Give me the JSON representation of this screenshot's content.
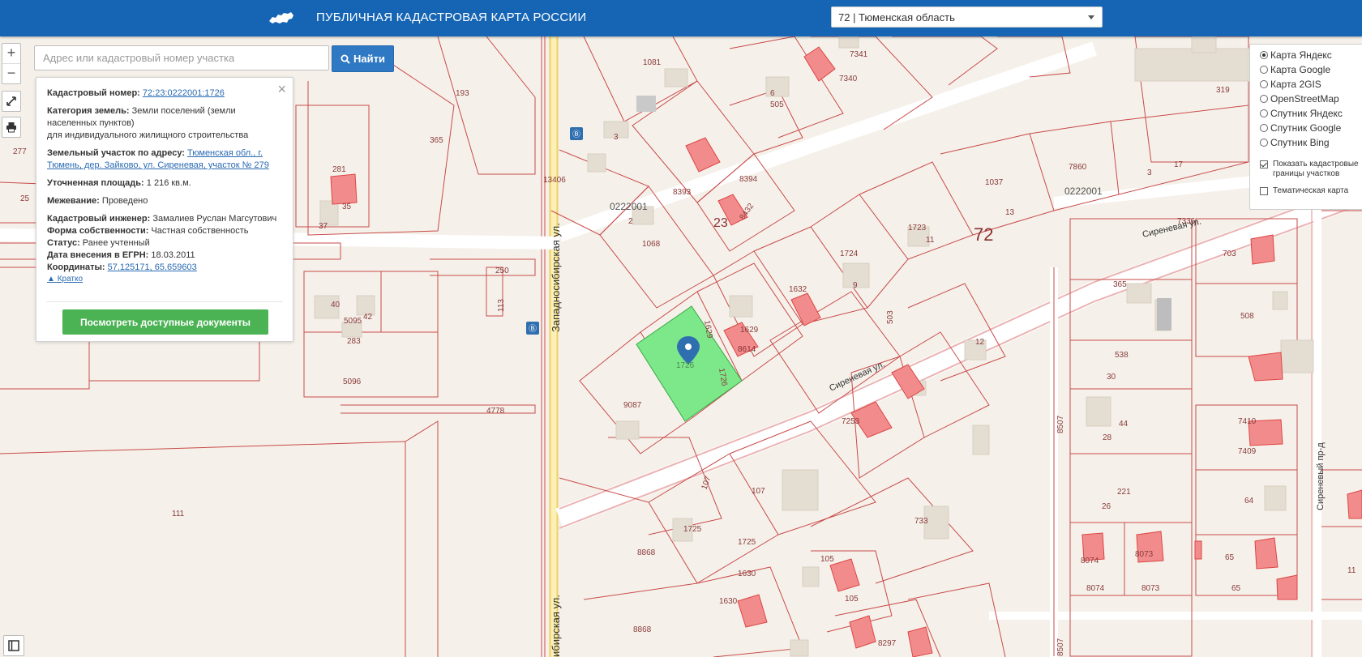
{
  "header": {
    "title": "ПУБЛИЧНАЯ КАДАСТРОВАЯ КАРТА РОССИИ",
    "region": "72 | Тюменская область"
  },
  "search": {
    "placeholder": "Адрес или кадастровый номер участка",
    "button": "Найти"
  },
  "zoom": {
    "in": "+",
    "out": "−"
  },
  "info": {
    "cadastral_label": "Кадастровый номер:",
    "cadastral_value": "72:23:0222001:1726",
    "category_label": "Категория земель:",
    "category_value": "Земли поселений (земли населенных пунктов)",
    "usage": "для индивидуального жилищного строительства",
    "address_label": "Земельный участок по адресу:",
    "address_value": "Тюменская обл., г. Тюмень, дер. Зайково, ул. Сиреневая, участок № 279",
    "area_label": "Уточненная площадь:",
    "area_value": "1 216 кв.м.",
    "survey_label": "Межевание:",
    "survey_value": "Проведено",
    "engineer_label": "Кадастровый инженер:",
    "engineer_value": "Замалиев Руслан Магсутович",
    "ownership_label": "Форма собственности:",
    "ownership_value": "Частная собственность",
    "status_label": "Статус:",
    "status_value": "Ранее учтенный",
    "egrn_label": "Дата внесения в ЕГРН:",
    "egrn_value": "18.03.2011",
    "coords_label": "Координаты:",
    "coords_value": "57.125171, 65.659603",
    "collapse": "Кратко",
    "docs_button": "Посмотреть доступные документы"
  },
  "layers": {
    "items": [
      {
        "label": "Карта Яндекс",
        "selected": true
      },
      {
        "label": "Карта Google",
        "selected": false
      },
      {
        "label": "Карта 2GIS",
        "selected": false
      },
      {
        "label": "OpenStreetMap",
        "selected": false
      },
      {
        "label": "Спутник Яндекс",
        "selected": false
      },
      {
        "label": "Спутник Google",
        "selected": false
      },
      {
        "label": "Спутник Bing",
        "selected": false
      }
    ],
    "show_borders": "Показать кадастровые границы участков",
    "show_borders_checked": true,
    "thematic": "Тематическая карта",
    "thematic_checked": false
  },
  "map": {
    "streets": {
      "zapadnosibirskaya": "Западносибирская ул.",
      "zapadnosibirskaya_bottom": "ибирская ул.",
      "sirenevaya": "Сиреневая ул.",
      "sirenevaya_upper": "Сиреневая ул.",
      "sirenevy_pr": "Сиреневый пр-д"
    },
    "labels": {
      "district_72": "72",
      "quarter_23": "23",
      "block_a": "0222001",
      "block_b": "0222001",
      "selected_parcel": "1726",
      "l1081": "1081",
      "l193": "193",
      "l365": "365",
      "l277": "277",
      "l25": "25",
      "l281": "281",
      "l35": "35",
      "l37": "37",
      "l3": "3",
      "l6": "6",
      "l505": "505",
      "l7341": "7341",
      "l7340": "7340",
      "l8393": "8393",
      "l8394": "8394",
      "l8432": "8432",
      "l13406": "13406",
      "l2": "2",
      "l1068": "1068",
      "l250": "250",
      "l113": "113",
      "l40": "40",
      "l5095": "5095",
      "l42": "42",
      "l283": "283",
      "l5096": "5096",
      "l4778": "4778",
      "l111": "111",
      "l1629": "1629",
      "l1632": "1632",
      "l9": "9",
      "l1724": "1724",
      "l1723": "1723",
      "l11": "11",
      "l1037": "1037",
      "l13": "13",
      "l7860": "7860",
      "l3b": "3",
      "l17": "17",
      "l319": "319",
      "l7336": "7336",
      "l703": "703",
      "l365b": "365",
      "l508": "508",
      "l503": "503",
      "l12": "12",
      "l9087": "9087",
      "l7253": "7253",
      "l538": "538",
      "l30": "30",
      "l44": "44",
      "l28": "28",
      "l221": "221",
      "l26": "26",
      "l7410": "7410",
      "l7409": "7409",
      "l64": "64",
      "l107": "107",
      "l1725": "1725",
      "l1725b": "1725",
      "l733": "733",
      "l8868": "8868",
      "l1630": "1630",
      "l1630b": "1630",
      "l105": "105",
      "l105b": "105",
      "l8297": "8297",
      "l8868b": "8868",
      "l8074": "8074",
      "l8073": "8073",
      "l8074b": "8074",
      "l8073b": "8073",
      "l65": "65",
      "l65b": "65",
      "l11b": "11",
      "l8507": "8507",
      "l8507b": "8507",
      "l8614": "8614",
      "l107b": "107"
    }
  }
}
